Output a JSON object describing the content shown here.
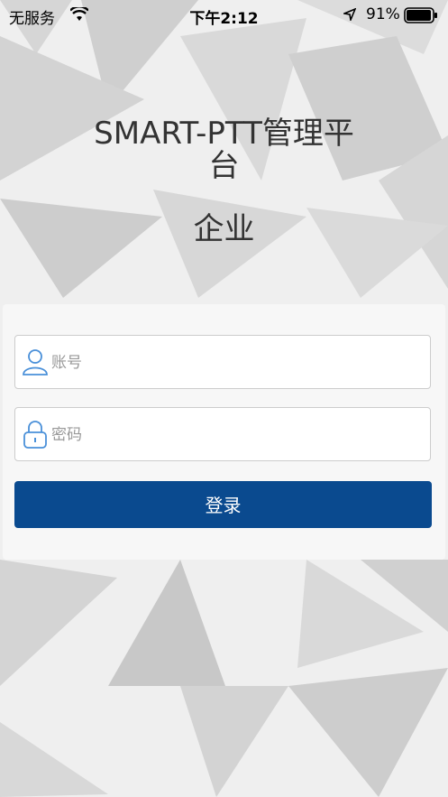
{
  "status_bar": {
    "carrier": "无服务",
    "time": "下午2:12",
    "battery_percent": "91%"
  },
  "header": {
    "title": "SMART-PTT管理平台",
    "subtitle": "企业"
  },
  "login_form": {
    "account_placeholder": "账号",
    "account_value": "",
    "password_placeholder": "密码",
    "password_value": "",
    "submit_label": "登录"
  },
  "icons": {
    "account": "user-icon",
    "password": "lock-icon",
    "wifi": "wifi-icon",
    "location": "location-arrow-icon",
    "battery": "battery-icon"
  },
  "colors": {
    "primary_button": "#0a4a8f",
    "field_icon": "#4a90d9",
    "background_light": "#f0f0f0",
    "background_shape": "#cfcfcf"
  }
}
